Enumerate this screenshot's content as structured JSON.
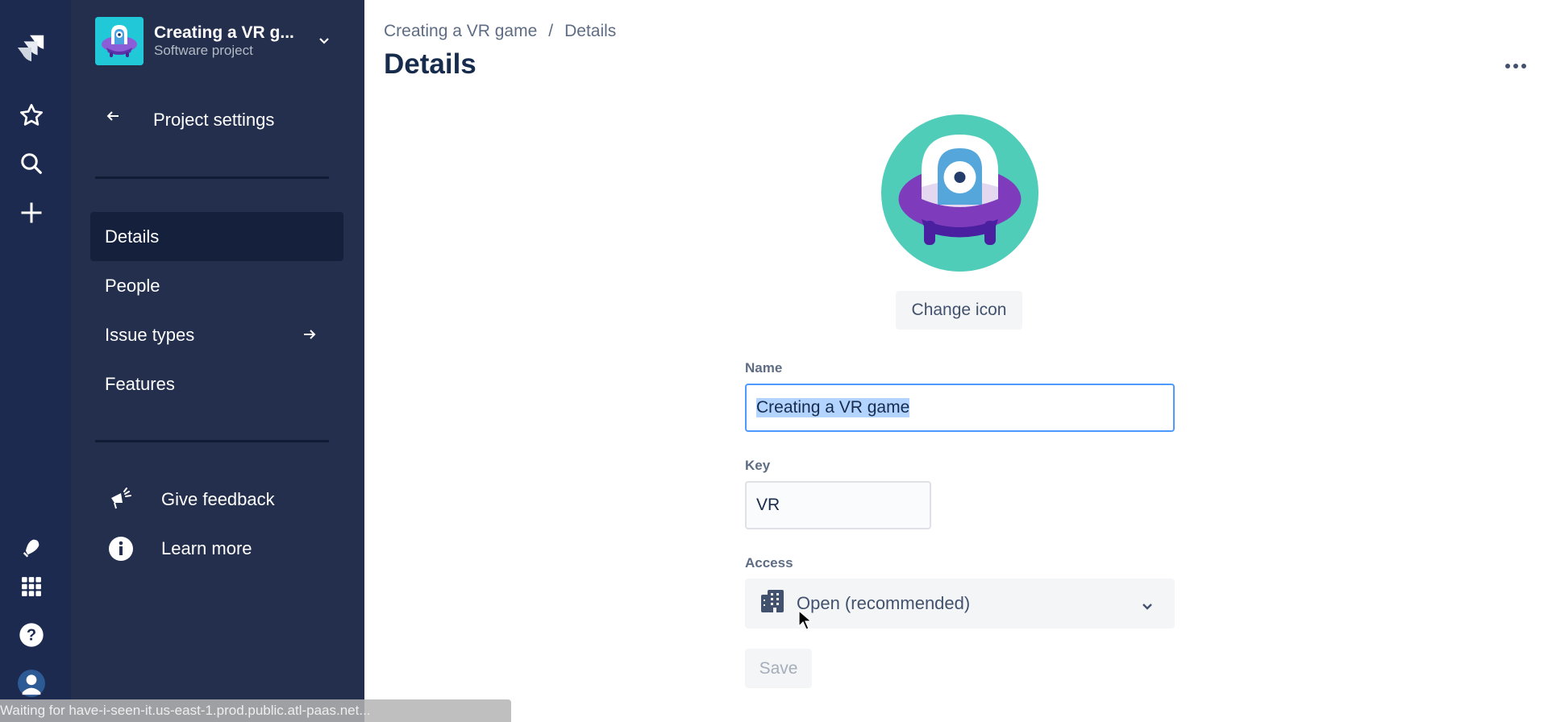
{
  "global_nav": {
    "icons": [
      "jira-logo-icon",
      "star-icon",
      "search-icon",
      "plus-icon",
      "notification-icon",
      "app-switcher-icon",
      "help-icon",
      "profile-avatar-icon"
    ]
  },
  "project": {
    "name": "Creating a VR g...",
    "type": "Software project"
  },
  "sidebar": {
    "back_label": "Project settings",
    "items": [
      {
        "label": "Details",
        "active": true
      },
      {
        "label": "People",
        "active": false
      },
      {
        "label": "Issue types",
        "active": false,
        "has_arrow": true
      },
      {
        "label": "Features",
        "active": false
      }
    ],
    "footer": [
      {
        "label": "Give feedback",
        "icon": "megaphone-icon"
      },
      {
        "label": "Learn more",
        "icon": "info-icon"
      }
    ]
  },
  "main": {
    "breadcrumb": [
      "Creating a VR game",
      "Details"
    ],
    "breadcrumb_sep": "/",
    "title": "Details",
    "change_icon_label": "Change icon",
    "form": {
      "name_label": "Name",
      "name_value": "Creating a VR game",
      "key_label": "Key",
      "key_value": "VR",
      "access_label": "Access",
      "access_value": "Open (recommended)",
      "save_label": "Save"
    }
  },
  "status_bar": {
    "text": "Waiting for have-i-seen-it.us-east-1.prod.public.atl-paas.net..."
  },
  "colors": {
    "global_nav_bg": "#1b2a4e",
    "project_nav_bg": "#232f4c",
    "active_item_bg": "#14203c",
    "focus_border": "#4c9aff",
    "avatar_bg": "#4fcdb9"
  }
}
